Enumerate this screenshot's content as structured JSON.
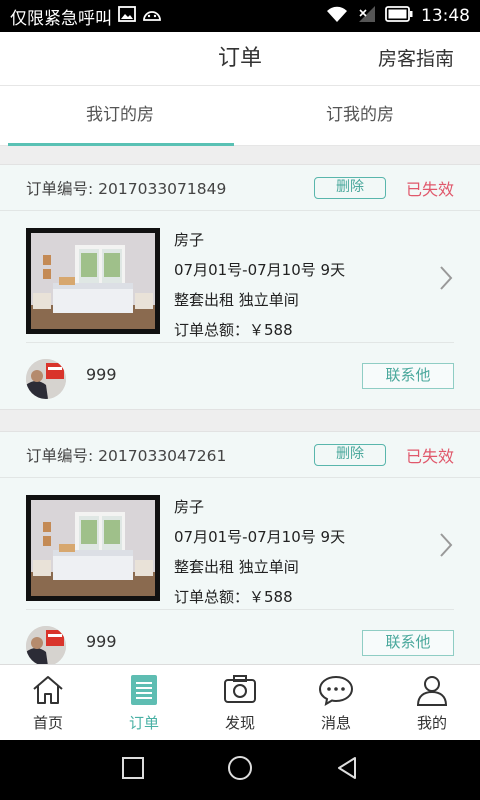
{
  "status_bar": {
    "carrier_text": "仅限紧急呼叫",
    "time": "13:48"
  },
  "header": {
    "title": "订单",
    "guide_label": "房客指南"
  },
  "tabs": [
    {
      "label": "我订的房",
      "active": true
    },
    {
      "label": "订我的房",
      "active": false
    }
  ],
  "orders": [
    {
      "order_no": "订单编号: 2017033071849",
      "delete_label": "删除",
      "status": "已失效",
      "house_name": "房子",
      "dates": "07月01号-07月10号  9天",
      "type": "整套出租 独立单间",
      "total": "订单总额：￥588",
      "host_name": "999",
      "contact_label": "联系他"
    },
    {
      "order_no": "订单编号: 2017033047261",
      "delete_label": "删除",
      "status": "已失效",
      "house_name": "房子",
      "dates": "07月01号-07月10号  9天",
      "type": "整套出租 独立单间",
      "total": "订单总额：￥588",
      "host_name": "999",
      "contact_label": "联系他"
    }
  ],
  "bottom_nav": [
    {
      "label": "首页",
      "icon": "home-icon"
    },
    {
      "label": "订单",
      "icon": "order-icon",
      "active": true
    },
    {
      "label": "发现",
      "icon": "camera-icon"
    },
    {
      "label": "消息",
      "icon": "message-icon"
    },
    {
      "label": "我的",
      "icon": "user-icon"
    }
  ],
  "colors": {
    "accent": "#59c1b4",
    "status_red": "#e0586b",
    "card_bg": "#f2f8f7"
  }
}
